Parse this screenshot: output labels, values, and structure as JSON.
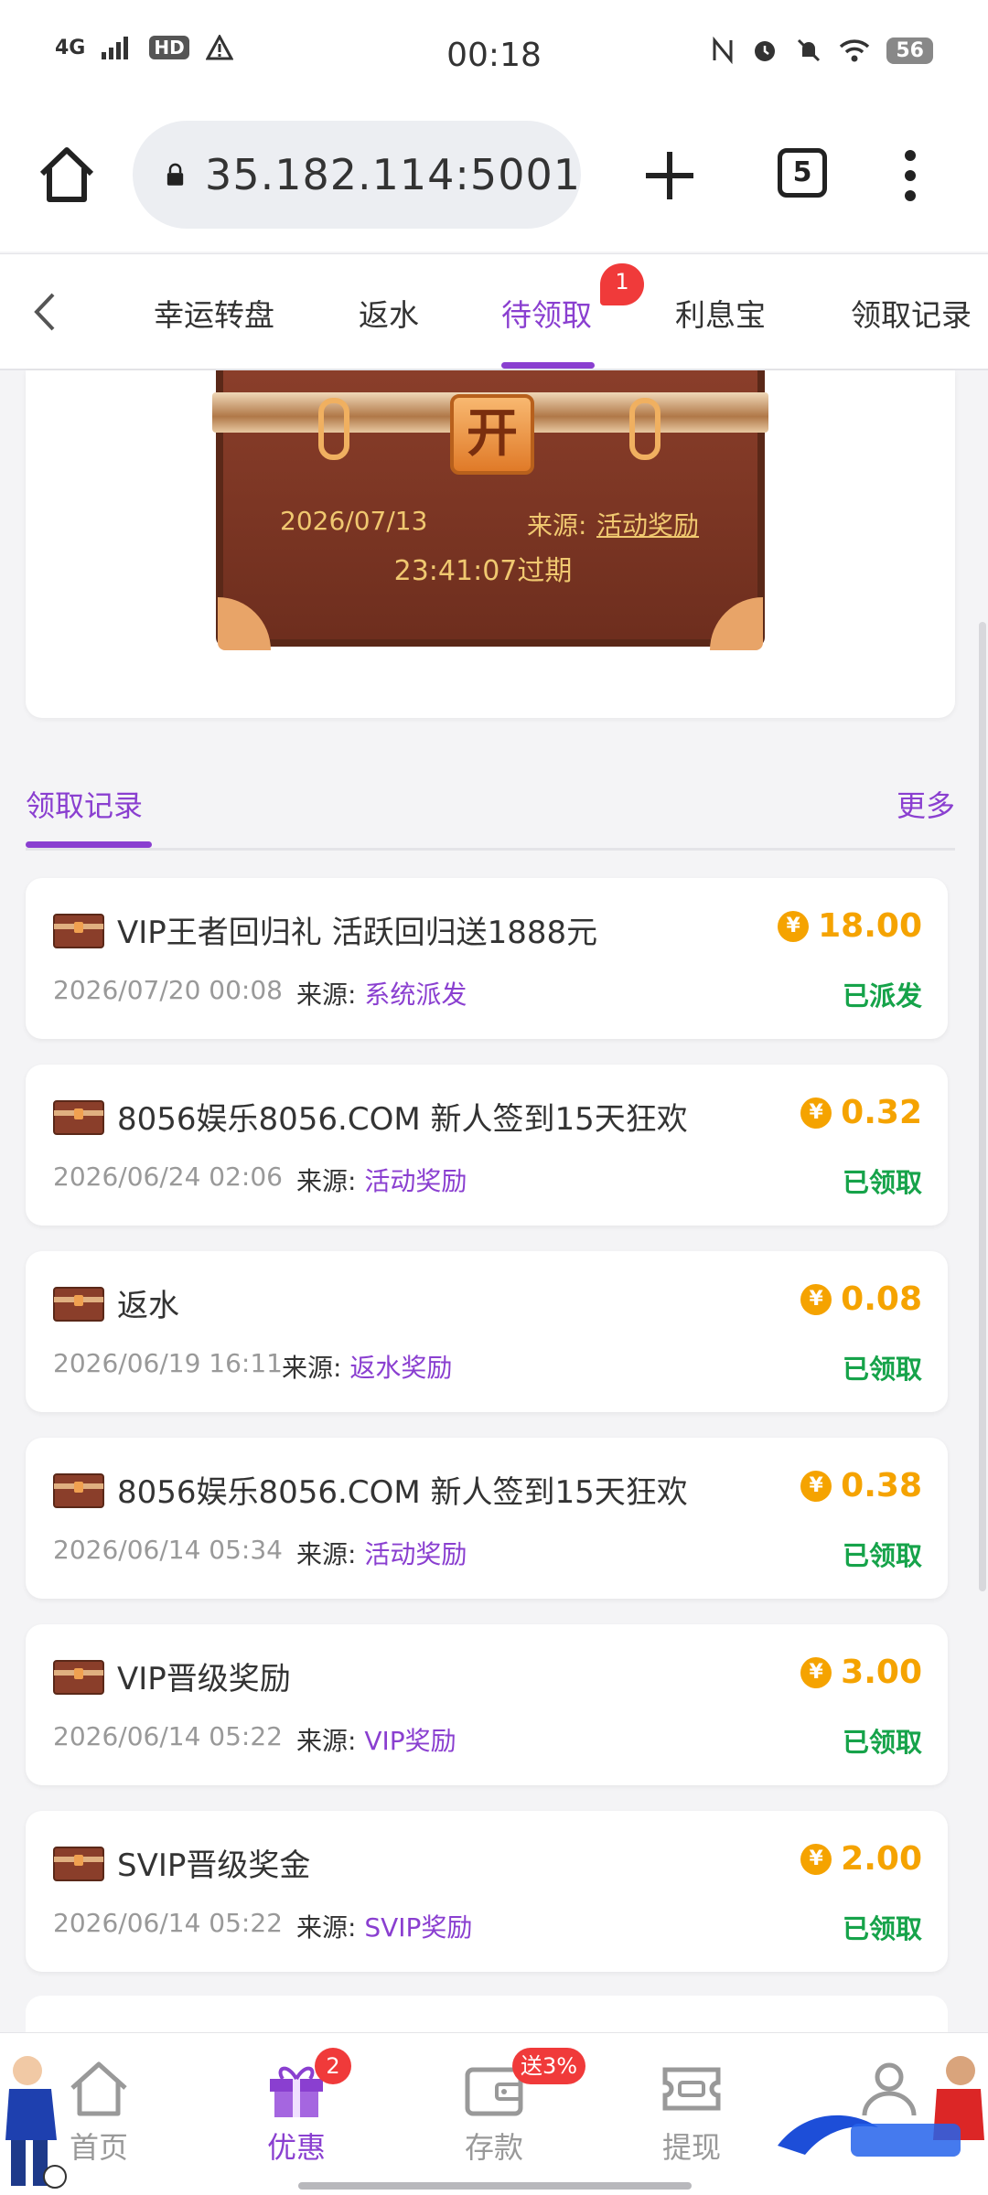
{
  "status_bar": {
    "network": "4G",
    "hd": "HD",
    "warning_icon": "warning-icon",
    "time": "00:18",
    "icons": [
      "nfc-icon",
      "alarm-icon",
      "mute-icon",
      "wifi-icon"
    ],
    "battery": "56"
  },
  "browser": {
    "url": "35.182.114:5001",
    "tab_count": "5",
    "icons": [
      "home-icon",
      "lock-icon",
      "plus-icon",
      "more-icon"
    ]
  },
  "tabs": {
    "items": [
      {
        "label": "幸运转盘"
      },
      {
        "label": "返水"
      },
      {
        "label": "待领取",
        "active": true,
        "badge": "1"
      },
      {
        "label": "利息宝"
      },
      {
        "label": "领取记录"
      }
    ]
  },
  "chest": {
    "open_label": "开",
    "date": "2026/07/13",
    "source_label": "来源:",
    "source": "活动奖励",
    "expiry": "23:41:07过期"
  },
  "records": {
    "title": "领取记录",
    "more": "更多",
    "source_prefix": "来源:",
    "items": [
      {
        "title": "VIP王者回归礼 活跃回归送1888元",
        "amount": "18.00",
        "date": "2026/07/20 00:08",
        "source": "系统派发",
        "status": "已派发"
      },
      {
        "title": "8056娱乐8056.COM 新人签到15天狂欢",
        "amount": "0.32",
        "date": "2026/06/24 02:06",
        "source": "活动奖励",
        "status": "已领取"
      },
      {
        "title": "返水",
        "amount": "0.08",
        "date": "2026/06/19 16:11",
        "source": "返水奖励",
        "status": "已领取"
      },
      {
        "title": "8056娱乐8056.COM 新人签到15天狂欢",
        "amount": "0.38",
        "date": "2026/06/14 05:34",
        "source": "活动奖励",
        "status": "已领取"
      },
      {
        "title": "VIP晋级奖励",
        "amount": "3.00",
        "date": "2026/06/14 05:22",
        "source": "VIP奖励",
        "status": "已领取"
      },
      {
        "title": "SVIP晋级奖金",
        "amount": "2.00",
        "date": "2026/06/14 05:22",
        "source": "SVIP奖励",
        "status": "已领取"
      }
    ]
  },
  "bottom_nav": {
    "items": [
      {
        "label": "首页",
        "icon": "home-icon"
      },
      {
        "label": "优惠",
        "icon": "gift-icon",
        "active": true,
        "badge": "2"
      },
      {
        "label": "存款",
        "icon": "wallet-icon",
        "badge": "送3%"
      },
      {
        "label": "提现",
        "icon": "ticket-icon"
      },
      {
        "label": "",
        "icon": "user-icon"
      }
    ]
  },
  "colors": {
    "accent": "#8a3fd0",
    "amount": "#f5a300",
    "status_green": "#16a34a",
    "badge_red": "#f03a3a"
  }
}
